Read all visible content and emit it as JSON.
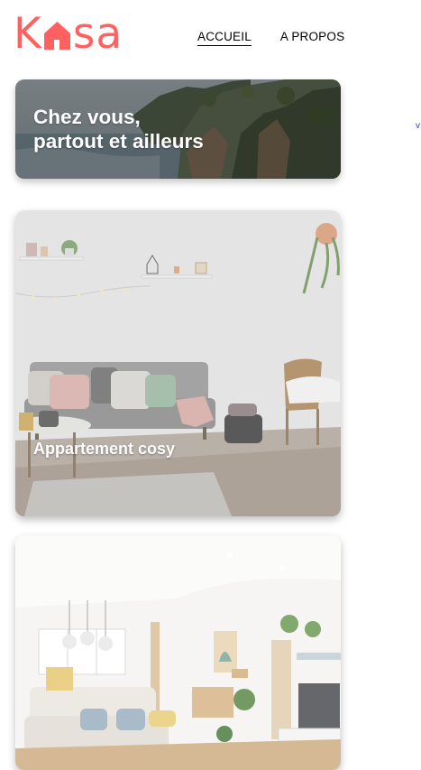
{
  "brand": {
    "logo_letters": [
      "K",
      "sa"
    ],
    "logo_icon": "house-icon",
    "color": "#ff6060"
  },
  "nav": {
    "items": [
      {
        "label": "ACCUEIL",
        "active": true
      },
      {
        "label": "A PROPOS",
        "active": false
      }
    ]
  },
  "banner": {
    "title_line1": "Chez vous,",
    "title_line2": "partout et ailleurs"
  },
  "listings": [
    {
      "title": "Appartement cosy"
    },
    {
      "title": ""
    }
  ]
}
